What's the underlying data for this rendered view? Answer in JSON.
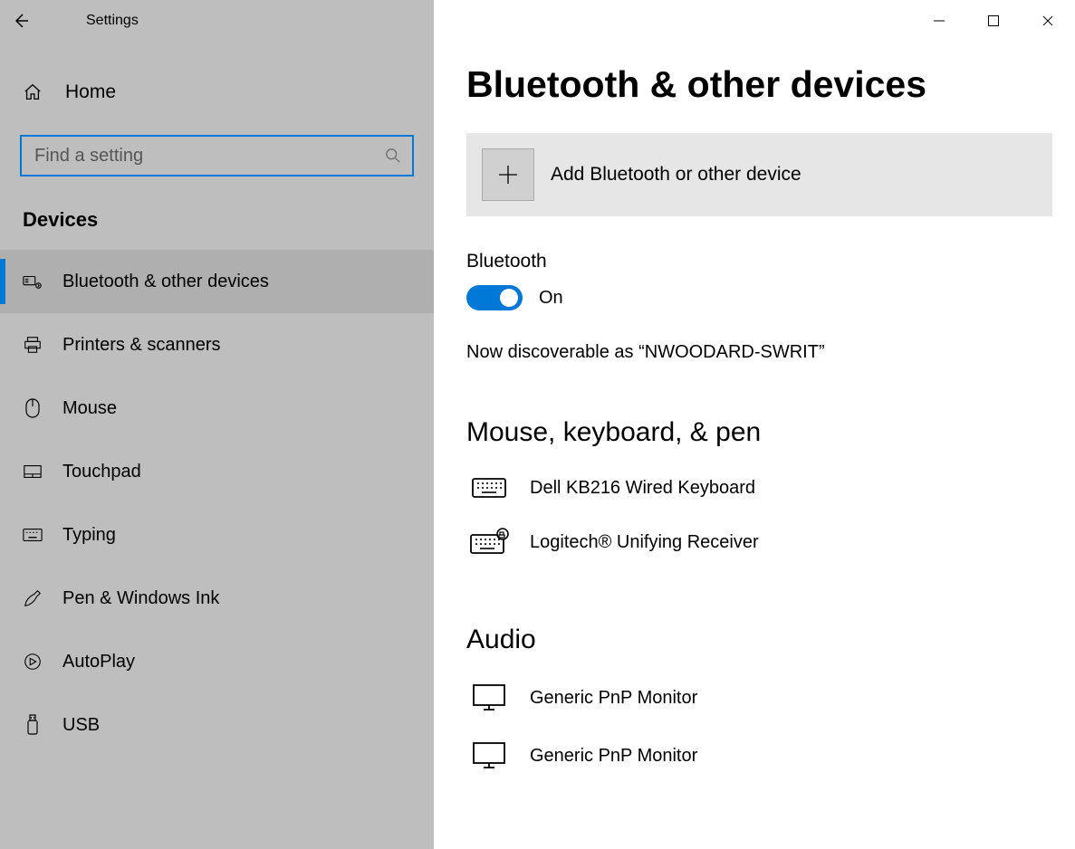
{
  "app_title": "Settings",
  "search_placeholder": "Find a setting",
  "home_label": "Home",
  "sidebar_section": "Devices",
  "nav": [
    {
      "label": "Bluetooth & other devices",
      "icon": "bluetooth-devices-icon",
      "selected": true
    },
    {
      "label": "Printers & scanners",
      "icon": "printer-icon",
      "selected": false
    },
    {
      "label": "Mouse",
      "icon": "mouse-icon",
      "selected": false
    },
    {
      "label": "Touchpad",
      "icon": "touchpad-icon",
      "selected": false
    },
    {
      "label": "Typing",
      "icon": "keyboard-icon",
      "selected": false
    },
    {
      "label": "Pen & Windows Ink",
      "icon": "pen-icon",
      "selected": false
    },
    {
      "label": "AutoPlay",
      "icon": "autoplay-icon",
      "selected": false
    },
    {
      "label": "USB",
      "icon": "usb-icon",
      "selected": false
    }
  ],
  "page": {
    "title": "Bluetooth & other devices",
    "add_device_label": "Add Bluetooth or other device",
    "bluetooth_label": "Bluetooth",
    "bluetooth_state": "On",
    "discoverable_text": "Now discoverable as “NWOODARD-SWRIT”",
    "sections": [
      {
        "title": "Mouse, keyboard, & pen",
        "devices": [
          {
            "name": "Dell KB216 Wired Keyboard",
            "icon": "keyboard-device-icon"
          },
          {
            "name": "Logitech® Unifying Receiver",
            "icon": "receiver-device-icon"
          }
        ]
      },
      {
        "title": "Audio",
        "devices": [
          {
            "name": "Generic PnP Monitor",
            "icon": "monitor-device-icon"
          },
          {
            "name": "Generic PnP Monitor",
            "icon": "monitor-device-icon"
          }
        ]
      }
    ]
  }
}
